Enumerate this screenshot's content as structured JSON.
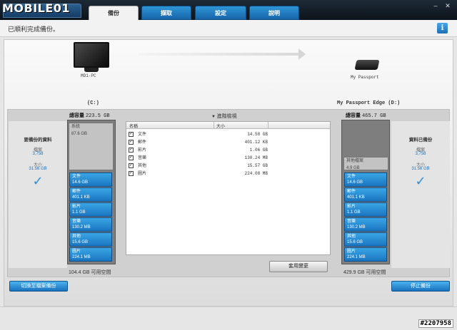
{
  "brand": {
    "text": "MOBILE01"
  },
  "tabs": [
    {
      "label": "備份",
      "active": true
    },
    {
      "label": "擷取",
      "active": false
    },
    {
      "label": "設定",
      "active": false
    },
    {
      "label": "說明",
      "active": false
    }
  ],
  "window_controls": {
    "minimize": "–",
    "close": "✕"
  },
  "status": {
    "message": "已順利完成備份。",
    "info_icon": "i"
  },
  "source": {
    "pc_name": "MD1-PC",
    "drive_label": "(C:)",
    "capacity_label": "總容量",
    "capacity_value": "223.5 GB",
    "available": "104.4 GB 可用空間"
  },
  "target": {
    "device_name": "My Passport",
    "drive_label": "My Passport Edge (D:)",
    "capacity_label": "總容量",
    "capacity_value": "465.7 GB",
    "available": "429.9 GB 可用空間"
  },
  "left_panel": {
    "title": "要備份的資料",
    "count_label": "檔案",
    "count_value": "3,758",
    "size_label": "大小",
    "size_value": "31.56 GB"
  },
  "right_panel": {
    "title": "資料已備份",
    "count_label": "檔案",
    "count_value": "3,758",
    "size_label": "大小",
    "size_value": "31.56 GB"
  },
  "source_volume": {
    "system": {
      "label": "系統",
      "value": "87.6 GB"
    },
    "segments": [
      {
        "label": "文件",
        "value": "14.6 GB"
      },
      {
        "label": "郵件",
        "value": "401.1 KB"
      },
      {
        "label": "影片",
        "value": "1.1 GB"
      },
      {
        "label": "音樂",
        "value": "130.2 MB"
      },
      {
        "label": "其他",
        "value": "15.6 GB"
      },
      {
        "label": "圖片",
        "value": "224.1 MB"
      }
    ]
  },
  "target_volume": {
    "other": {
      "label": "其他檔案",
      "value": "4.9 GB"
    },
    "segments": [
      {
        "label": "文件",
        "value": "14.6 GB"
      },
      {
        "label": "郵件",
        "value": "401.1 KB"
      },
      {
        "label": "影片",
        "value": "1.1 GB"
      },
      {
        "label": "音樂",
        "value": "130.2 MB"
      },
      {
        "label": "其他",
        "value": "15.6 GB"
      },
      {
        "label": "圖片",
        "value": "224.1 MB"
      }
    ]
  },
  "advanced": {
    "toggle_label": "進階檢視",
    "columns": [
      "名稱",
      "大小"
    ],
    "rows": [
      {
        "name": "文件",
        "size": "14.58 GB",
        "checked": true
      },
      {
        "name": "郵件",
        "size": "401.12 KB",
        "checked": true
      },
      {
        "name": "影片",
        "size": "1.06 GB",
        "checked": true
      },
      {
        "name": "音樂",
        "size": "130.24 MB",
        "checked": true
      },
      {
        "name": "其他",
        "size": "15.57 GB",
        "checked": true
      },
      {
        "name": "圖片",
        "size": "224.08 MB",
        "checked": true
      }
    ],
    "apply_button": "套用變更"
  },
  "buttons": {
    "switch_file_backup": "切換至檔案備份",
    "stop_backup": "停止備份"
  },
  "watermark": "#2207958"
}
